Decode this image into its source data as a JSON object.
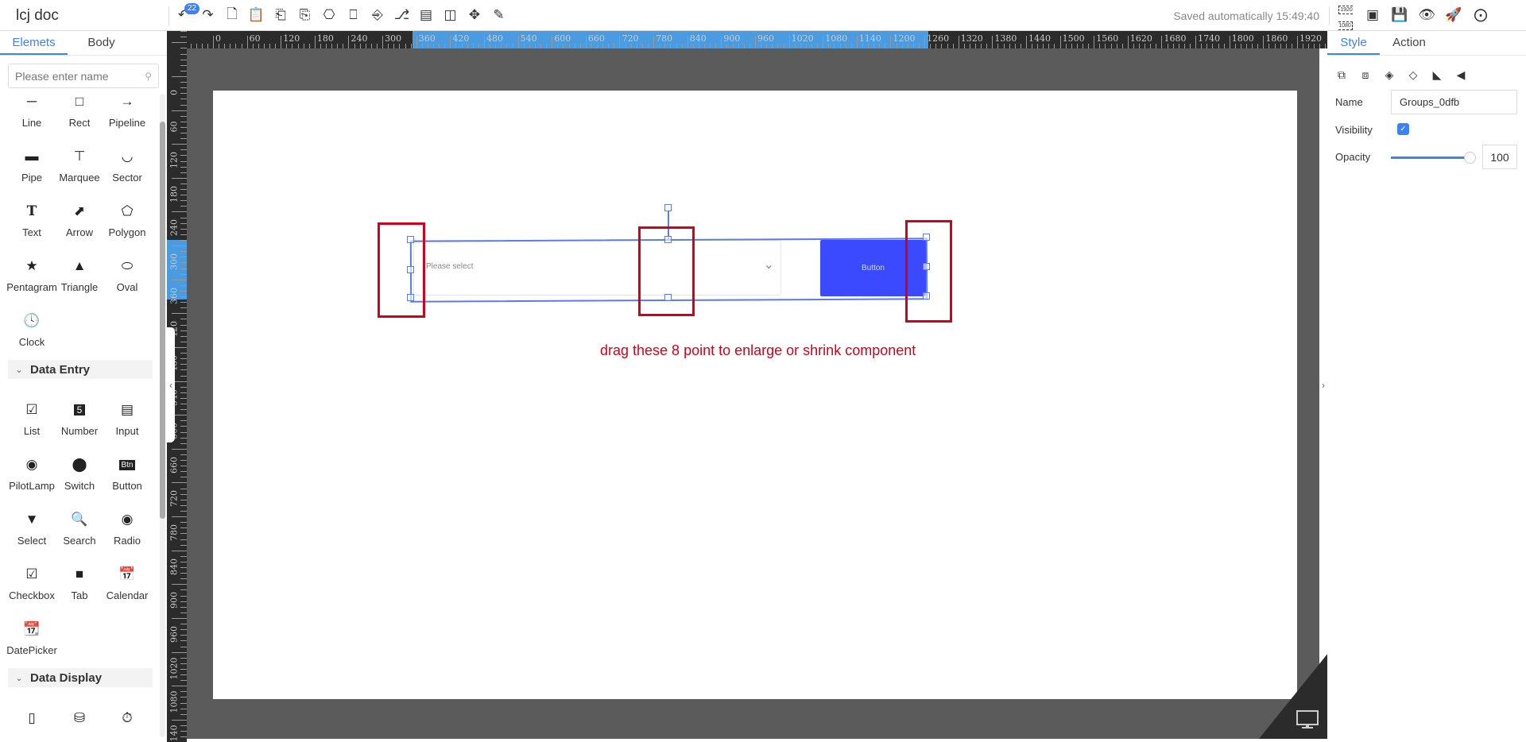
{
  "app": {
    "title": "lcj doc",
    "saved_status": "Saved automatically 15:49:40",
    "undo_count": "22"
  },
  "toolbar": {
    "left": [
      "undo-icon",
      "redo-icon",
      "copy-icon",
      "paste-icon",
      "align-left-icon",
      "align-right-icon",
      "align-top-icon",
      "align-bottom-icon",
      "align-horizontal-center-icon",
      "align-vertical-center-icon",
      "distribute-horizontal-icon",
      "distribute-vertical-icon",
      "move-icon",
      "brush-icon"
    ],
    "right": [
      "resolution-1920x1080-icon",
      "fit-screen-icon",
      "save-icon",
      "preview-icon",
      "publish-icon",
      "share-icon"
    ],
    "resolution_text": "1920 1080"
  },
  "left_panel": {
    "tabs": [
      {
        "label": "Elemets",
        "active": true
      },
      {
        "label": "Body",
        "active": false
      }
    ],
    "search_placeholder": "Please enter name",
    "basic_items": [
      {
        "label": "Line",
        "icon": "line-icon"
      },
      {
        "label": "Rect",
        "icon": "rect-icon"
      },
      {
        "label": "Pipeline",
        "icon": "pipeline-icon"
      },
      {
        "label": "Pipe",
        "icon": "pipe-icon"
      },
      {
        "label": "Marquee",
        "icon": "marquee-icon"
      },
      {
        "label": "Sector",
        "icon": "sector-icon"
      },
      {
        "label": "Text",
        "icon": "text-icon"
      },
      {
        "label": "Arrow",
        "icon": "arrow-icon"
      },
      {
        "label": "Polygon",
        "icon": "polygon-icon"
      },
      {
        "label": "Pentagram",
        "icon": "star-icon"
      },
      {
        "label": "Triangle",
        "icon": "triangle-icon"
      },
      {
        "label": "Oval",
        "icon": "oval-icon"
      },
      {
        "label": "Clock",
        "icon": "clock-icon"
      }
    ],
    "data_entry": {
      "title": "Data Entry",
      "items": [
        {
          "label": "List",
          "icon": "list-icon"
        },
        {
          "label": "Number",
          "icon": "number-icon"
        },
        {
          "label": "Input",
          "icon": "input-icon"
        },
        {
          "label": "PilotLamp",
          "icon": "pilot-lamp-icon"
        },
        {
          "label": "Switch",
          "icon": "switch-icon"
        },
        {
          "label": "Button",
          "icon": "button-icon"
        },
        {
          "label": "Select",
          "icon": "select-icon"
        },
        {
          "label": "Search",
          "icon": "search-icon"
        },
        {
          "label": "Radio",
          "icon": "radio-icon"
        },
        {
          "label": "Checkbox",
          "icon": "checkbox-icon"
        },
        {
          "label": "Tab",
          "icon": "tab-icon"
        },
        {
          "label": "Calendar",
          "icon": "calendar-icon"
        },
        {
          "label": "DatePicker",
          "icon": "date-picker-icon"
        }
      ]
    },
    "data_display": {
      "title": "Data Display",
      "items": [
        {
          "icon": "battery-icon"
        },
        {
          "icon": "cup-icon"
        },
        {
          "icon": "gauge-icon"
        }
      ]
    }
  },
  "canvas": {
    "select_placeholder": "Please select",
    "button_label": "Button",
    "annotation": "drag these 8 point to enlarge or shrink component",
    "annotation_color": "#d0021b",
    "accent": "#3b4aff",
    "ruler_h_max": 1920,
    "ruler_v_max": 1140,
    "ruler_step": 60
  },
  "right_panel": {
    "tabs": [
      {
        "label": "Style",
        "active": true
      },
      {
        "label": "Action",
        "active": false
      }
    ],
    "icons": [
      "bring-front-icon",
      "send-back-icon",
      "layer-up-icon",
      "layer-down-icon",
      "flip-horizontal-icon",
      "flip-vertical-icon"
    ],
    "name_label": "Name",
    "name_value": "Groups_0dfb",
    "visibility_label": "Visibility",
    "visibility": true,
    "opacity_label": "Opacity",
    "opacity_value": "100"
  }
}
